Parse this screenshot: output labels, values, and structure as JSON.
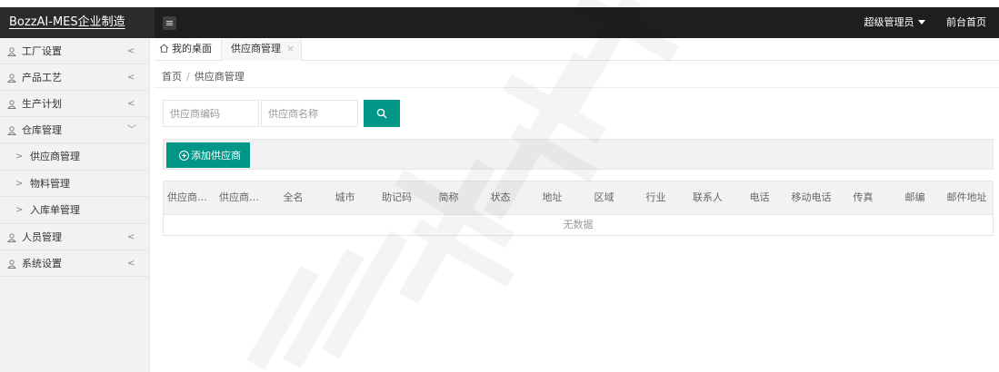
{
  "app": {
    "title": "BozzAI-MES企业制造",
    "user_menu": "超级管理员",
    "front_link": "前台首页"
  },
  "sidebar": {
    "items": [
      {
        "label": "工厂设置",
        "arrow": "<"
      },
      {
        "label": "产品工艺",
        "arrow": "<"
      },
      {
        "label": "生产计划",
        "arrow": "<"
      },
      {
        "label": "仓库管理",
        "arrow": "﹀"
      },
      {
        "label": "人员管理",
        "arrow": "<"
      },
      {
        "label": "系统设置",
        "arrow": "<"
      }
    ],
    "subitems": [
      {
        "label": "供应商管理",
        "arrow": ">"
      },
      {
        "label": "物料管理",
        "arrow": ">"
      },
      {
        "label": "入库单管理",
        "arrow": ">"
      }
    ]
  },
  "tabs": {
    "home": "我的桌面",
    "active": "供应商管理",
    "close": "×"
  },
  "breadcrumb": {
    "home": "首页",
    "sep": "/",
    "current": "供应商管理"
  },
  "search": {
    "code_placeholder": "供应商编码",
    "name_placeholder": "供应商名称"
  },
  "toolbar": {
    "add_label": "添加供应商"
  },
  "table": {
    "columns": [
      "供应商编码",
      "供应商名称",
      "全名",
      "城市",
      "助记码",
      "简称",
      "状态",
      "地址",
      "区域",
      "行业",
      "联系人",
      "电话",
      "移动电话",
      "传真",
      "邮编",
      "邮件地址"
    ],
    "empty_text": "无数据"
  },
  "colors": {
    "accent": "#009688",
    "topbar": "#1e1e1e",
    "sidebar": "#f2f2f2"
  }
}
